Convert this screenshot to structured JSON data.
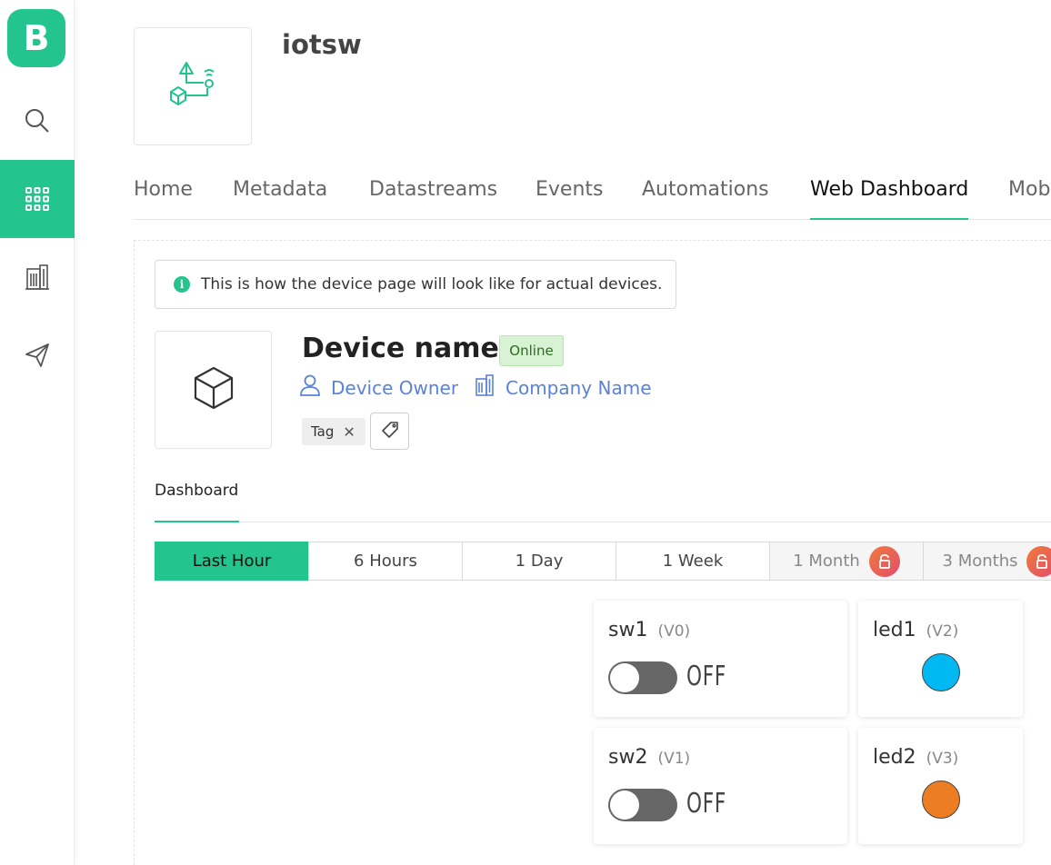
{
  "sidebar": {
    "logo_letter": "B",
    "items": [
      {
        "name": "search"
      },
      {
        "name": "grid",
        "active": true
      },
      {
        "name": "organizations"
      },
      {
        "name": "send"
      }
    ]
  },
  "product": {
    "title": "iotsw"
  },
  "tabs": [
    {
      "label": "Home"
    },
    {
      "label": "Metadata"
    },
    {
      "label": "Datastreams"
    },
    {
      "label": "Events"
    },
    {
      "label": "Automations"
    },
    {
      "label": "Web Dashboard",
      "active": true
    },
    {
      "label": "Mob"
    }
  ],
  "notice": {
    "text": "This is how the device page will look like for actual devices."
  },
  "device": {
    "name": "Device name",
    "status": "Online",
    "owner": "Device Owner",
    "company": "Company Name",
    "tag": "Tag"
  },
  "subtabs": {
    "dashboard": "Dashboard"
  },
  "time_range": [
    {
      "label": "Last Hour",
      "active": true
    },
    {
      "label": "6 Hours"
    },
    {
      "label": "1 Day"
    },
    {
      "label": "1 Week"
    },
    {
      "label": "1 Month",
      "locked": true
    },
    {
      "label": "3 Months",
      "locked": true
    }
  ],
  "widgets": {
    "sw1": {
      "name": "sw1",
      "pin": "(V0)",
      "state": "OFF"
    },
    "led1": {
      "name": "led1",
      "pin": "(V2)",
      "color": "#00b9f2"
    },
    "sw2": {
      "name": "sw2",
      "pin": "(V1)",
      "state": "OFF"
    },
    "led2": {
      "name": "led2",
      "pin": "(V3)",
      "color": "#ed7d23"
    }
  },
  "colors": {
    "accent": "#23c48e",
    "link": "#5b82d9",
    "online_bg": "#d8f3d3"
  }
}
